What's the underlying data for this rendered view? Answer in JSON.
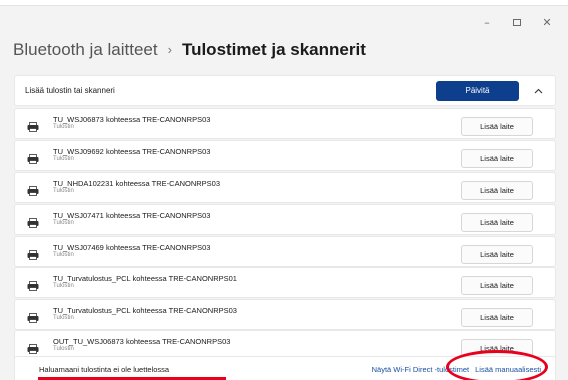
{
  "window": {
    "minimize_glyph": "–",
    "close_glyph": "✕"
  },
  "header": {
    "parent": "Bluetooth ja laitteet",
    "separator": "›",
    "current": "Tulostimet ja skannerit"
  },
  "add_section": {
    "label": "Lisää tulostin tai skanneri",
    "refresh_button": "Päivitä",
    "collapse_icon": "chevron-up-icon"
  },
  "devices": [
    {
      "name": "TU_WSJ06873 kohteessa TRE-CANONRPS03",
      "type": "Tulostin",
      "button": "Lisää laite"
    },
    {
      "name": "TU_WSJ09692 kohteessa TRE-CANONRPS03",
      "type": "Tulostin",
      "button": "Lisää laite"
    },
    {
      "name": "TU_NHDA102231 kohteessa TRE-CANONRPS03",
      "type": "Tulostin",
      "button": "Lisää laite"
    },
    {
      "name": "TU_WSJ07471 kohteessa TRE-CANONRPS03",
      "type": "Tulostin",
      "button": "Lisää laite"
    },
    {
      "name": "TU_WSJ07469 kohteessa TRE-CANONRPS03",
      "type": "Tulostin",
      "button": "Lisää laite"
    },
    {
      "name": "TU_Turvatulostus_PCL kohteessa TRE-CANONRPS01",
      "type": "Tulostin",
      "button": "Lisää laite"
    },
    {
      "name": "TU_Turvatulostus_PCL kohteessa TRE-CANONRPS03",
      "type": "Tulostin",
      "button": "Lisää laite"
    },
    {
      "name": "OUT_TU_WSJ06873 kohteessa TRE-CANONRPS03",
      "type": "Tulostin",
      "button": "Lisää laite"
    }
  ],
  "footer": {
    "note": "Haluamaani tulostinta ei ole luettelossa",
    "wifi_link": "Näytä Wi-Fi Direct -tulostimet",
    "manual_link": "Lisää manuaalisesti"
  },
  "colors": {
    "accent": "#0e3f8c",
    "link": "#1a4fa0",
    "annotation": "#e8001c"
  }
}
